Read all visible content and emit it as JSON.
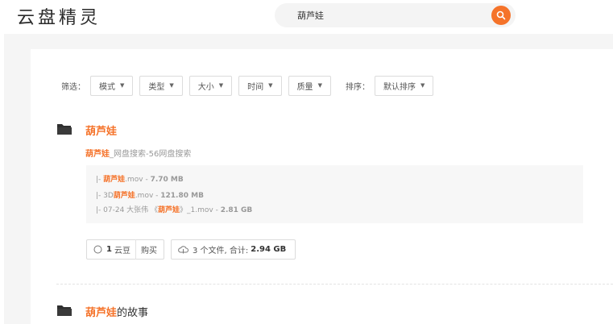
{
  "header": {
    "logo": "云盘精灵",
    "search_value": "葫芦娃"
  },
  "filters": {
    "label": "筛选：",
    "items": [
      "模式",
      "类型",
      "大小",
      "时间",
      "质量"
    ],
    "sort_label": "排序：",
    "sort_value": "默认排序"
  },
  "results": [
    {
      "title_hl": "葫芦娃",
      "title_rest": "",
      "sub_hl": "葫芦娃",
      "sub_rest": "_网盘搜索-56网盘搜索",
      "files": [
        {
          "prefix": "|- ",
          "hl": "葫芦娃",
          "rest": ".mov - ",
          "size": "7.70 MB"
        },
        {
          "prefix": "|- 3D",
          "hl": "葫芦娃",
          "rest": ".mov - ",
          "size": "121.80 MB"
        },
        {
          "prefix": "|- 07-24 大张伟 《",
          "hl": "葫芦娃",
          "rest": "》_1.mov - ",
          "size": "2.81 GB"
        }
      ],
      "chip_price_num": "1",
      "chip_price_unit": "云豆",
      "chip_buy": "购买",
      "chip_files_text": "3 个文件, 合计:",
      "chip_files_total": "2.94 GB"
    },
    {
      "title_hl": "葫芦娃",
      "title_rest": "的故事"
    }
  ],
  "colors": {
    "accent": "#f5732a"
  }
}
